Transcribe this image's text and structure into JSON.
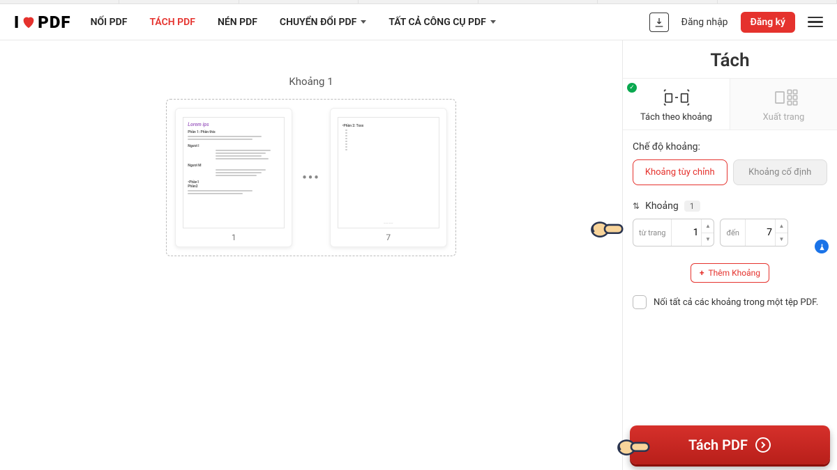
{
  "logo": {
    "pre": "I",
    "post": "PDF"
  },
  "nav": {
    "noi": "NỐI PDF",
    "tach": "TÁCH PDF",
    "nen": "NÉN PDF",
    "chuyendoi": "CHUYỂN ĐỔI PDF",
    "tatca": "TẤT CẢ CÔNG CỤ PDF",
    "login": "Đăng nhập",
    "signup": "Đăng ký"
  },
  "canvas": {
    "range_title": "Khoảng 1",
    "page_from": "1",
    "page_to": "7"
  },
  "sidebar": {
    "title": "Tách",
    "tab_range": "Tách theo khoảng",
    "tab_extract": "Xuất trang",
    "mode_label": "Chế độ khoảng:",
    "mode_custom": "Khoảng tùy chỉnh",
    "mode_fixed": "Khoảng cố định",
    "range_label": "Khoảng",
    "range_num": "1",
    "from_label": "từ trang",
    "from_val": "1",
    "to_label": "đến",
    "to_val": "7",
    "add_range": "Thêm Khoảng",
    "merge_label": "Nối tất cả các khoảng trong một tệp PDF.",
    "action": "Tách PDF"
  }
}
